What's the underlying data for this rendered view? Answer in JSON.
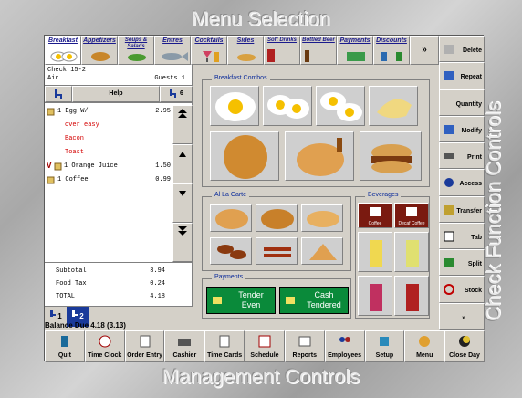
{
  "frame": {
    "title_top": "Menu Selection",
    "title_bottom": "Management Controls",
    "title_right": "Check Function Controls"
  },
  "tabs": [
    {
      "label": "Breakfast",
      "icon": "eggs-icon",
      "active": true
    },
    {
      "label": "Appetizers",
      "icon": "appetizer-icon"
    },
    {
      "label": "Soups & Salads",
      "icon": "salad-icon"
    },
    {
      "label": "Entres",
      "icon": "fish-icon"
    },
    {
      "label": "Cocktails",
      "icon": "cocktail-icon"
    },
    {
      "label": "Sides",
      "icon": "sides-icon"
    },
    {
      "label": "Soft Drinks",
      "icon": "soda-icon"
    },
    {
      "label": "Bottled Beer",
      "icon": "beer-icon"
    },
    {
      "label": "Payments",
      "icon": "money-icon"
    },
    {
      "label": "Discounts",
      "icon": "discount-icon"
    }
  ],
  "more_label": "»",
  "check": {
    "line1": "Check 15-2",
    "line2_left": "Air",
    "line2_right": "Guests 1",
    "help_label": "Help",
    "seat_count": "6",
    "items": [
      {
        "qty": "1",
        "name": "1 Egg W/",
        "price": "2.95",
        "mod": false,
        "icon": true
      },
      {
        "qty": "",
        "name": "over easy",
        "price": "",
        "mod": true
      },
      {
        "qty": "",
        "name": "Bacon",
        "price": "",
        "mod": true
      },
      {
        "qty": "",
        "name": "Toast",
        "price": "",
        "mod": true
      },
      {
        "qty": "1",
        "name": "1 Orange Juice",
        "price": "1.50",
        "mod": false,
        "icon": true,
        "v": true
      },
      {
        "qty": "",
        "name": "1 Coffee",
        "price": "0.99",
        "mod": false,
        "icon": true
      }
    ],
    "subtotal_label": "Subtotal",
    "subtotal": "3.94",
    "tax_label": "Food Tax",
    "tax": "0.24",
    "total_label": "TOTAL",
    "total": "4.18",
    "seat1": "1",
    "seat2": "2",
    "balance": "Balance Due   4.18 (3.13)"
  },
  "groups": {
    "breakfast_combos": "Breakfast Combos",
    "ala_carte": "Al La Carte",
    "payments": "Payments",
    "beverages": "Beverages"
  },
  "pay": {
    "tender_even": "Tender Even",
    "cash_tendered": "Cash Tendered"
  },
  "beverages": {
    "coffee": "Coffee",
    "decaf": "Decaf Coffee"
  },
  "controls": [
    {
      "label": "Delete",
      "icon": "delete-icon"
    },
    {
      "label": "Repeat",
      "icon": "repeat-icon"
    },
    {
      "label": "Quantity",
      "icon": ""
    },
    {
      "label": "Modify",
      "icon": "modify-icon"
    },
    {
      "label": "Print",
      "icon": "print-icon"
    },
    {
      "label": "Access",
      "icon": "access-icon"
    },
    {
      "label": "Transfer",
      "icon": "transfer-icon"
    },
    {
      "label": "Tab",
      "icon": "tab-icon"
    },
    {
      "label": "Split",
      "icon": "split-icon"
    },
    {
      "label": "Stock",
      "icon": "stock-icon"
    },
    {
      "label": "»",
      "icon": ""
    }
  ],
  "toolbar": [
    {
      "label": "Quit",
      "icon": "quit-icon"
    },
    {
      "label": "Time Clock",
      "icon": "clock-icon"
    },
    {
      "label": "Order Entry",
      "icon": "order-icon"
    },
    {
      "label": "Cashier",
      "icon": "cashier-icon"
    },
    {
      "label": "Time Cards",
      "icon": "timecard-icon"
    },
    {
      "label": "Schedule",
      "icon": "schedule-icon"
    },
    {
      "label": "Reports",
      "icon": "reports-icon"
    },
    {
      "label": "Employees",
      "icon": "employees-icon"
    },
    {
      "label": "Setup",
      "icon": "setup-icon"
    },
    {
      "label": "Menu",
      "icon": "menu-icon"
    },
    {
      "label": "Close Day",
      "icon": "closeday-icon"
    }
  ],
  "colors": {
    "accent": "#1a1a8c",
    "modifier": "#d40000",
    "pay_green": "#0a8a3a"
  }
}
